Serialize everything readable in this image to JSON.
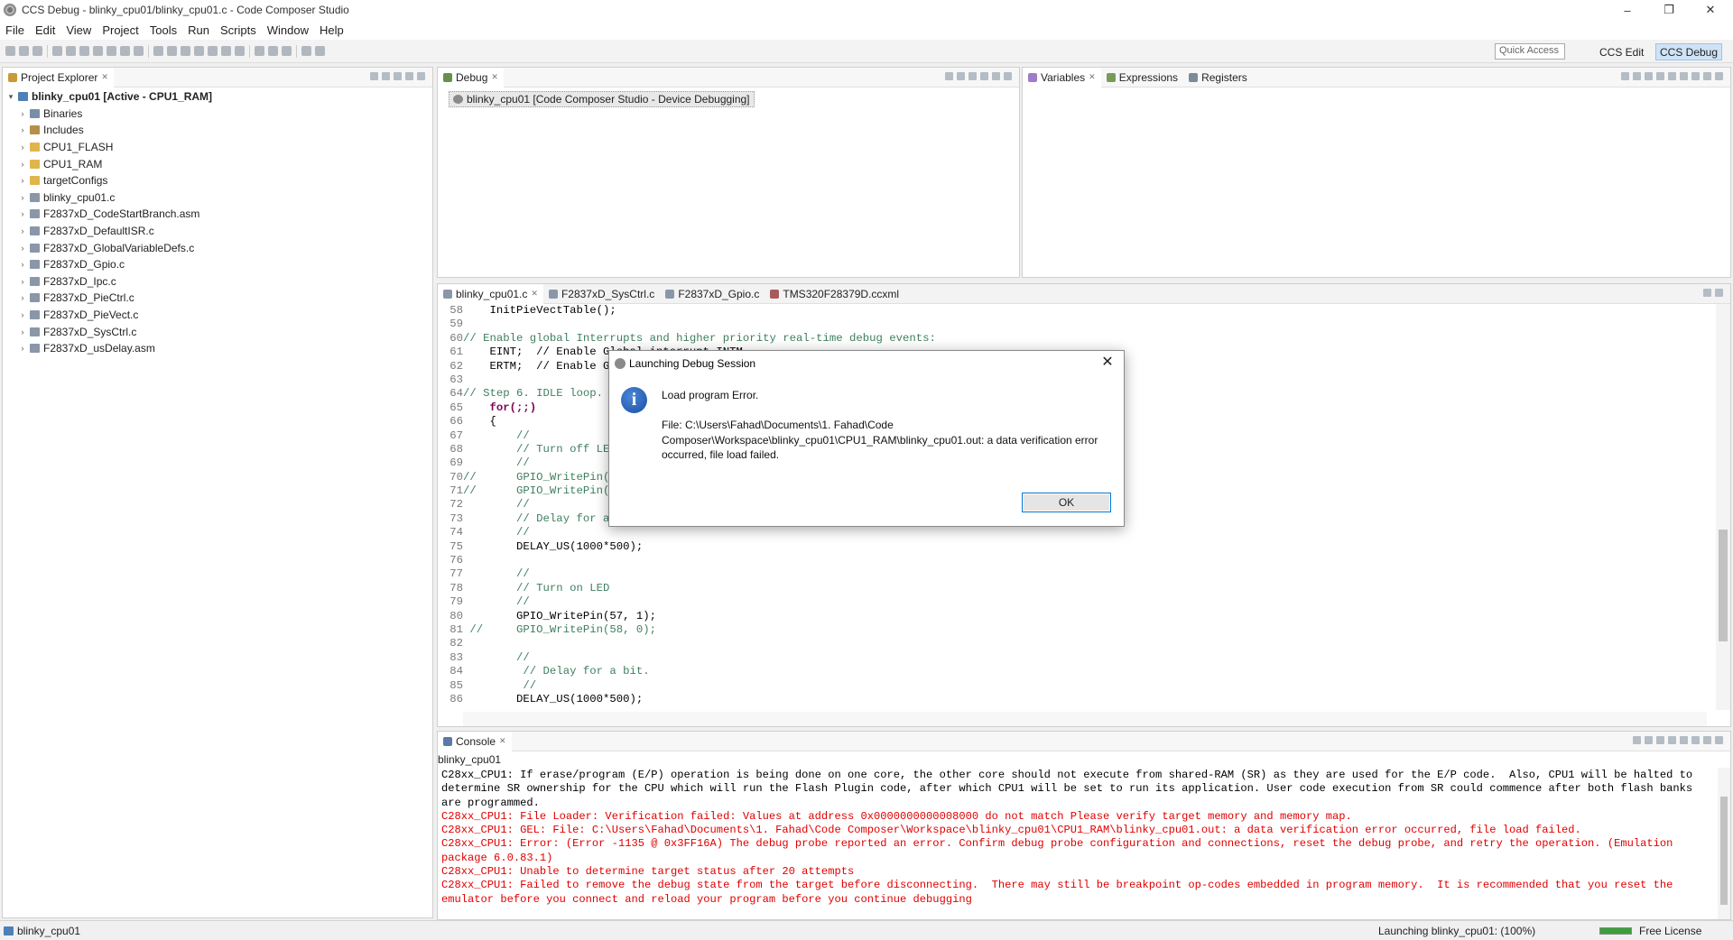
{
  "window": {
    "title": "CCS Debug - blinky_cpu01/blinky_cpu01.c - Code Composer Studio",
    "minimize": "–",
    "restore": "❐",
    "close": "✕"
  },
  "menu": [
    "File",
    "Edit",
    "View",
    "Project",
    "Tools",
    "Run",
    "Scripts",
    "Window",
    "Help"
  ],
  "toolbar": {
    "quick_access_placeholder": "Quick Access",
    "perspectives": [
      {
        "label": "CCS Edit",
        "active": false
      },
      {
        "label": "CCS Debug",
        "active": true
      }
    ]
  },
  "project_explorer": {
    "tab_label": "Project Explorer",
    "root": "blinky_cpu01  [Active - CPU1_RAM]",
    "items": [
      {
        "label": "Binaries",
        "icon": "binaries-icon"
      },
      {
        "label": "Includes",
        "icon": "includes-icon"
      },
      {
        "label": "CPU1_FLASH",
        "icon": "folder-icon"
      },
      {
        "label": "CPU1_RAM",
        "icon": "folder-icon"
      },
      {
        "label": "targetConfigs",
        "icon": "folder-icon"
      },
      {
        "label": "blinky_cpu01.c",
        "icon": "c-file-icon"
      },
      {
        "label": "F2837xD_CodeStartBranch.asm",
        "icon": "asm-file-icon"
      },
      {
        "label": "F2837xD_DefaultISR.c",
        "icon": "c-file-icon"
      },
      {
        "label": "F2837xD_GlobalVariableDefs.c",
        "icon": "c-file-icon"
      },
      {
        "label": "F2837xD_Gpio.c",
        "icon": "c-file-icon"
      },
      {
        "label": "F2837xD_Ipc.c",
        "icon": "c-file-icon"
      },
      {
        "label": "F2837xD_PieCtrl.c",
        "icon": "c-file-icon"
      },
      {
        "label": "F2837xD_PieVect.c",
        "icon": "c-file-icon"
      },
      {
        "label": "F2837xD_SysCtrl.c",
        "icon": "c-file-icon"
      },
      {
        "label": "F2837xD_usDelay.asm",
        "icon": "asm-file-icon"
      }
    ]
  },
  "debug_view": {
    "tab_label": "Debug",
    "session": "blinky_cpu01 [Code Composer Studio - Device Debugging]"
  },
  "variables_view": {
    "tabs": [
      "Variables",
      "Expressions",
      "Registers"
    ]
  },
  "editor": {
    "tabs": [
      "blinky_cpu01.c",
      "F2837xD_SysCtrl.c",
      "F2837xD_Gpio.c",
      "TMS320F28379D.ccxml"
    ],
    "lines": [
      {
        "n": "58",
        "text": "    InitPieVectTable();",
        "style": "ct"
      },
      {
        "n": "59",
        "text": "",
        "style": "ct"
      },
      {
        "n": "60",
        "text": "// Enable global Interrupts and higher priority real-time debug events:",
        "style": "ct cm"
      },
      {
        "n": "61",
        "text": "    EINT;  // Enable Global interrupt INTM",
        "style": "ct"
      },
      {
        "n": "62",
        "text": "    ERTM;  // Enable Global realtime interrupt DBGM",
        "style": "ct"
      },
      {
        "n": "63",
        "text": "",
        "style": "ct"
      },
      {
        "n": "64",
        "text": "// Step 6. IDLE loop. Just sit and loop forever (optional):",
        "style": "ct cm"
      },
      {
        "n": "65",
        "text": "    for(;;)",
        "style": "ct kw"
      },
      {
        "n": "66",
        "text": "    {",
        "style": "ct"
      },
      {
        "n": "67",
        "text": "        //",
        "style": "ct cm"
      },
      {
        "n": "68",
        "text": "        // Turn off LED",
        "style": "ct cm"
      },
      {
        "n": "69",
        "text": "        //",
        "style": "ct cm"
      },
      {
        "n": "70",
        "text": "//      GPIO_WritePin(57, 0);",
        "style": "ct cm"
      },
      {
        "n": "71",
        "text": "//      GPIO_WritePin(58, 1);",
        "style": "ct cm"
      },
      {
        "n": "72",
        "text": "        //",
        "style": "ct cm"
      },
      {
        "n": "73",
        "text": "        // Delay for a bit.",
        "style": "ct cm"
      },
      {
        "n": "74",
        "text": "        //",
        "style": "ct cm"
      },
      {
        "n": "75",
        "text": "        DELAY_US(1000*500);",
        "style": "ct"
      },
      {
        "n": "76",
        "text": "",
        "style": "ct"
      },
      {
        "n": "77",
        "text": "        //",
        "style": "ct cm"
      },
      {
        "n": "78",
        "text": "        // Turn on LED",
        "style": "ct cm"
      },
      {
        "n": "79",
        "text": "        //",
        "style": "ct cm"
      },
      {
        "n": "80",
        "text": "        GPIO_WritePin(57, 1);",
        "style": "ct"
      },
      {
        "n": "81",
        "text": " //     GPIO_WritePin(58, 0);",
        "style": "ct cm"
      },
      {
        "n": "82",
        "text": "",
        "style": "ct"
      },
      {
        "n": "83",
        "text": "        //",
        "style": "ct cm"
      },
      {
        "n": "84",
        "text": "         // Delay for a bit.",
        "style": "ct cm"
      },
      {
        "n": "85",
        "text": "         //",
        "style": "ct cm"
      },
      {
        "n": "86",
        "text": "        DELAY_US(1000*500);",
        "style": "ct"
      }
    ]
  },
  "console": {
    "tab_label": "Console",
    "session": "blinky_cpu01",
    "messages": [
      {
        "color": "c-black",
        "text": "C28xx_CPU1: If erase/program (E/P) operation is being done on one core, the other core should not execute from shared-RAM (SR) as they are used for the E/P code.  Also, CPU1 will be halted to determine SR ownership for the CPU which will run the Flash Plugin code, after which CPU1 will be set to run its application. User code execution from SR could commence after both flash banks are programmed."
      },
      {
        "color": "c-red",
        "text": "C28xx_CPU1: File Loader: Verification failed: Values at address 0x0000000000008000 do not match Please verify target memory and memory map."
      },
      {
        "color": "c-red",
        "text": "C28xx_CPU1: GEL: File: C:\\Users\\Fahad\\Documents\\1. Fahad\\Code Composer\\Workspace\\blinky_cpu01\\CPU1_RAM\\blinky_cpu01.out: a data verification error occurred, file load failed."
      },
      {
        "color": "c-red",
        "text": "C28xx_CPU1: Error: (Error -1135 @ 0x3FF16A) The debug probe reported an error. Confirm debug probe configuration and connections, reset the debug probe, and retry the operation. (Emulation package 6.0.83.1)"
      },
      {
        "color": "c-red",
        "text": "C28xx_CPU1: Unable to determine target status after 20 attempts"
      },
      {
        "color": "c-red",
        "text": "C28xx_CPU1: Failed to remove the debug state from the target before disconnecting.  There may still be breakpoint op-codes embedded in program memory.  It is recommended that you reset the emulator before you connect and reload your program before you continue debugging"
      }
    ]
  },
  "status": {
    "left": "blinky_cpu01",
    "progress": "Launching blinky_cpu01: (100%)",
    "license": "Free License"
  },
  "dialog": {
    "title": "Launching Debug Session",
    "heading": "Load program Error.",
    "file_line1": "File: C:\\Users\\Fahad\\Documents\\1. Fahad\\Code",
    "file_line2": "Composer\\Workspace\\blinky_cpu01\\CPU1_RAM\\blinky_cpu01.out: a data verification error",
    "file_line3": "occurred, file load failed.",
    "ok_label": "OK",
    "info_glyph": "i",
    "close_glyph": "✕"
  },
  "colors": {
    "accent": "#0078d7",
    "error_text": "#e00000",
    "comment": "#3f7f5f",
    "keyword": "#7f0055"
  }
}
